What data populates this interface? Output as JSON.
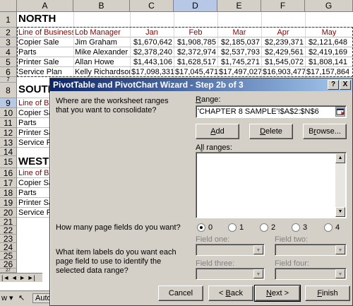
{
  "columns": [
    "A",
    "B",
    "C",
    "D",
    "E",
    "F",
    "G"
  ],
  "selected_column": "D",
  "row_numbers": [
    "1",
    "2",
    "3",
    "4",
    "5",
    "6",
    "7",
    "8",
    "9",
    "10",
    "11",
    "12",
    "13",
    "14",
    "15",
    "16",
    "17",
    "18",
    "19",
    "20",
    "21",
    "22",
    "23",
    "24",
    "25",
    "26",
    "27"
  ],
  "north": {
    "title": "NORTH",
    "headers": [
      "Line of Business",
      "Lob Manager",
      "Jan",
      "Feb",
      "Mar",
      "Apr",
      "May"
    ],
    "rows": [
      [
        "Copier Sale",
        "Jim Graham",
        "$1,670,642",
        "$1,908,785",
        "$2,185,037",
        "$2,239,371",
        "$2,121,648"
      ],
      [
        "Parts",
        "Mike Alexander",
        "$2,378,240",
        "$2,372,974",
        "$2,537,793",
        "$2,429,561",
        "$2,419,169"
      ],
      [
        "Printer Sale",
        "Allan Howe",
        "$1,443,106",
        "$1,628,517",
        "$1,745,271",
        "$1,545,072",
        "$1,808,141"
      ],
      [
        "Service Plan",
        "Kelly Richardson",
        "$17,098,331",
        "$17,045,471",
        "$17,497,027",
        "$16,903,477",
        "$17,157,864"
      ]
    ]
  },
  "south": {
    "title": "SOUTI",
    "header": "Line of Bu",
    "rows": [
      "Copier Sal",
      "Parts",
      "Printer Sal",
      "Service Pl"
    ]
  },
  "west": {
    "title": "WEST",
    "header": "Line of Bu",
    "rows": [
      "Copier Sal",
      "Parts",
      "Printer Sal",
      "Service Pl"
    ]
  },
  "sheet_tab_nav": "|◄ ◄ ► ►|",
  "drawbar": {
    "draw": "w ▾",
    "arrow": "↖",
    "autoshapes": "Auto"
  },
  "dialog": {
    "title": "PivotTable and PivotChart Wizard - Step 2b of 3",
    "help_button": "?",
    "close_button": "X",
    "question_ranges": "Where are the worksheet ranges that you want to consolidate?",
    "range_label": "Range:",
    "range_value": "'CHAPTER 8 SAMPLE'!$A$2:$N$6",
    "add_label": "Add",
    "delete_label": "Delete",
    "browse_label": "Browse...",
    "all_ranges_label": "All ranges:",
    "question_pagefields": "How many page fields do you want?",
    "page_field_options": [
      "0",
      "1",
      "2",
      "3",
      "4"
    ],
    "selected_page_fields": "0",
    "question_item_labels": "What item labels do you want each page field to use to identify the selected data range?",
    "field_one_label": "Field one:",
    "field_two_label": "Field two:",
    "field_three_label": "Field three:",
    "field_four_label": "Field four:",
    "cancel_label": "Cancel",
    "back_label": "< Back",
    "next_label": "Next >",
    "finish_label": "Finish"
  },
  "colors": {
    "header_red": "#8b0000",
    "titlebar_start": "#0a246a",
    "titlebar_end": "#a6caf0",
    "face": "#d4d0c8"
  }
}
